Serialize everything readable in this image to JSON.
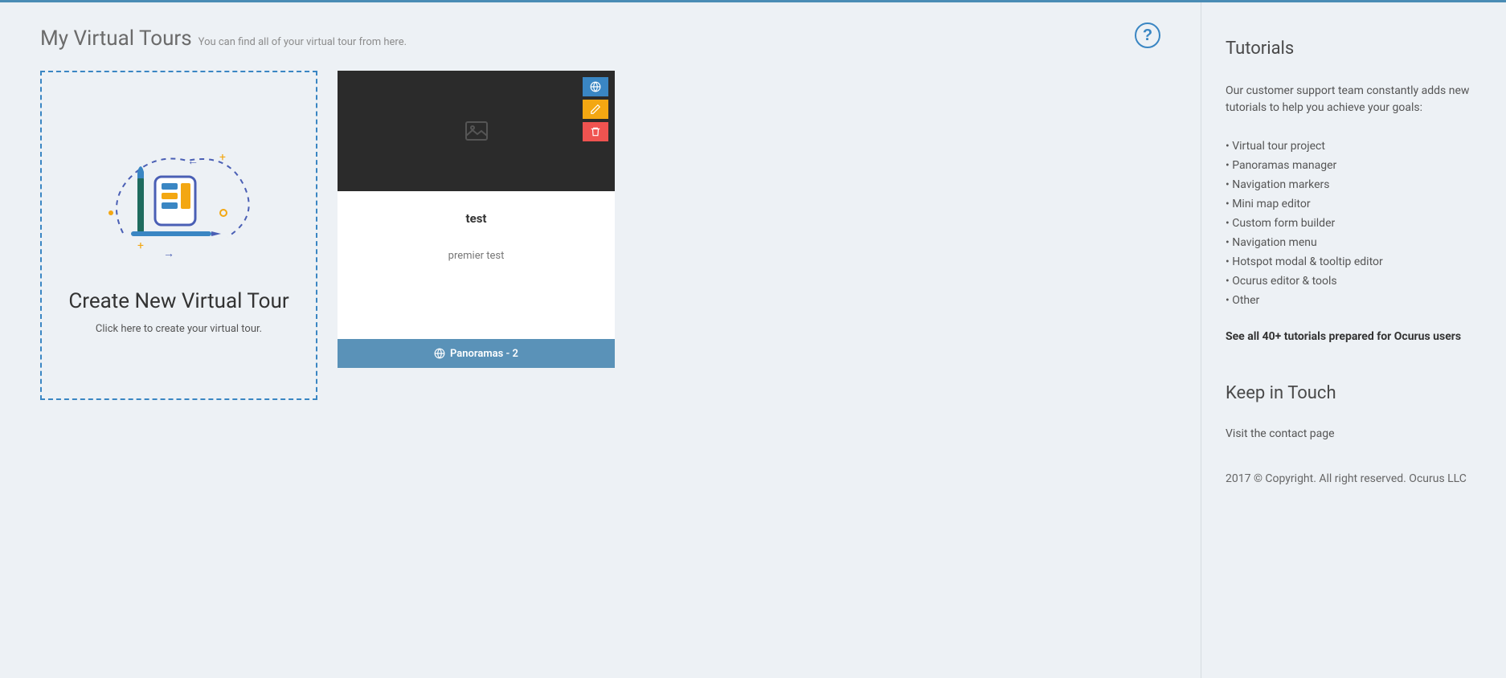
{
  "header": {
    "title": "My Virtual Tours",
    "subtitle": "You can find all of your virtual tour from here.",
    "help_label": "?"
  },
  "create_card": {
    "title": "Create New Virtual Tour",
    "hint": "Click here to create your virtual tour."
  },
  "tours": [
    {
      "title": "test",
      "description": "premier test",
      "footer_label": "Panoramas - 2"
    }
  ],
  "sidebar": {
    "tutorials_heading": "Tutorials",
    "intro": "Our customer support team constantly adds new tutorials to help you achieve your goals:",
    "items": [
      "Virtual tour project",
      "Panoramas manager",
      "Navigation markers",
      "Mini map editor",
      "Custom form builder",
      "Navigation menu",
      "Hotspot modal & tooltip editor",
      "Ocurus editor & tools",
      "Other"
    ],
    "see_all": "See all 40+ tutorials prepared for Ocurus users",
    "keep_in_touch_heading": "Keep in Touch",
    "contact": "Visit the contact page",
    "copyright": "2017 © Copyright. All right reserved. Ocurus LLC"
  }
}
